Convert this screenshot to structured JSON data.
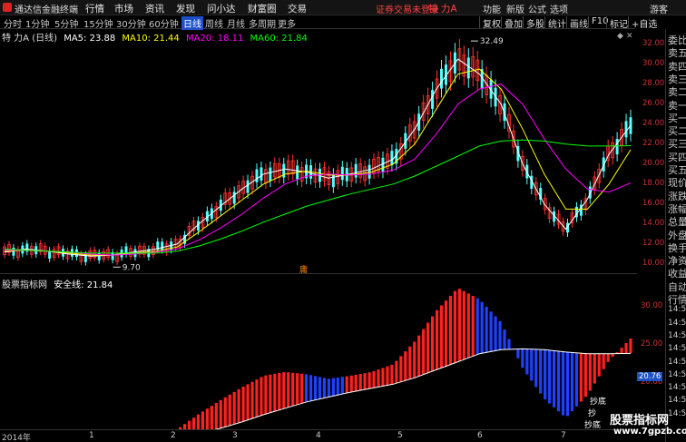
{
  "app": {
    "title": "通达信金融终端",
    "menu": [
      "行情",
      "市场",
      "资讯",
      "发现",
      "问小达",
      "财富圈",
      "交易"
    ],
    "notice": "证券交易未登录",
    "security": "特 力A",
    "menu_right": [
      "功能",
      "新版",
      "公式",
      "选项",
      "游客"
    ]
  },
  "toolbar": {
    "periods": [
      "分时",
      "1分钟",
      "5分钟",
      "15分钟",
      "30分钟",
      "60分钟",
      "日线",
      "周线",
      "月线",
      "多周期",
      "更多"
    ],
    "active_period": "日线",
    "functions": [
      "复权",
      "叠加",
      "多股",
      "统计",
      "画线",
      "F10",
      "标记",
      "+自选"
    ]
  },
  "main_legend": {
    "name": "特 力A (日线)",
    "ma5": "MA5: 23.88",
    "ma10": "MA10: 21.44",
    "ma20": "MA20: 18.11",
    "ma60": "MA60: 21.84"
  },
  "indicator_legend": {
    "name": "股票指标网",
    "label": "安全线: 21.84"
  },
  "price_axis": [
    "32.00",
    "30.00",
    "28.00",
    "26.00",
    "24.00",
    "22.00",
    "20.00",
    "18.00",
    "16.00",
    "14.00",
    "12.00",
    "10.00"
  ],
  "indicator_axis": [
    "30.00",
    "25.00",
    "20.00"
  ],
  "indicator_value": "20.76",
  "date_axis": [
    "2014年",
    "1",
    "2",
    "3",
    "4",
    "5",
    "6",
    "7"
  ],
  "annotations": {
    "high": "32.49",
    "low": "9.70",
    "marker": "庸",
    "buy_labels": [
      "抄底",
      "抄",
      "抄底"
    ]
  },
  "quote_panel": [
    "委比",
    "卖五",
    "卖四",
    "卖三",
    "卖二",
    "卖一",
    "买一",
    "买二",
    "买三",
    "买四",
    "买五",
    "现价",
    "涨跌",
    "涨幅",
    "总量",
    "外盘",
    "换手",
    "净资",
    "收益",
    "自动",
    "行情",
    "14:55",
    "14:56",
    "14:56",
    "14:56",
    "14:56",
    "14:56",
    "14:56",
    "14:56",
    "14:56"
  ],
  "watermark": {
    "name": "股票指标网",
    "url": "www.7gpzb.com"
  },
  "colors": {
    "up": "#ff3232",
    "down": "#54ffff",
    "ma5": "#ffffff",
    "ma10": "#ffff00",
    "ma20": "#ff00ff",
    "ma60": "#00ff00",
    "red_bar": "#ff2020",
    "blue_bar": "#2040ff",
    "safe_line": "#ffffff"
  },
  "chart_data": {
    "type": "line",
    "series": [
      {
        "name": "MA5",
        "values": [
          11.2,
          11.5,
          11.3,
          11.0,
          10.8,
          10.9,
          11.2,
          11.5,
          12.0,
          14.0,
          15.8,
          17.5,
          19.0,
          19.5,
          19.2,
          18.6,
          19.0,
          19.5,
          20.5,
          23.5,
          27.5,
          30.5,
          29.0,
          26.0,
          20.0,
          16.0,
          13.5,
          16.5,
          21.0,
          23.88
        ]
      },
      {
        "name": "MA10",
        "values": [
          11.3,
          11.4,
          11.3,
          11.1,
          10.9,
          10.9,
          11.1,
          11.3,
          11.7,
          13.2,
          14.8,
          16.4,
          18.0,
          19.0,
          19.3,
          18.9,
          18.9,
          19.2,
          20.0,
          22.0,
          25.5,
          29.0,
          29.5,
          27.5,
          23.5,
          19.0,
          15.5,
          15.5,
          18.0,
          21.44
        ]
      },
      {
        "name": "MA20",
        "values": [
          11.4,
          11.4,
          11.3,
          11.2,
          11.0,
          10.9,
          11.0,
          11.2,
          11.5,
          12.4,
          13.6,
          15.0,
          16.6,
          18.0,
          18.8,
          19.0,
          18.9,
          19.0,
          19.4,
          20.5,
          23.0,
          26.0,
          27.5,
          28.0,
          26.0,
          22.5,
          19.5,
          17.5,
          17.2,
          18.11
        ]
      },
      {
        "name": "MA60",
        "values": [
          11.5,
          11.4,
          11.3,
          11.2,
          11.1,
          11.1,
          11.1,
          11.1,
          11.3,
          11.8,
          12.5,
          13.3,
          14.2,
          15.0,
          15.8,
          16.4,
          17.0,
          17.5,
          18.0,
          18.8,
          19.8,
          20.8,
          21.8,
          22.3,
          22.4,
          22.3,
          22.0,
          21.8,
          21.8,
          21.84
        ]
      }
    ],
    "ylim": [
      9.0,
      33.5
    ],
    "annotations": {
      "high": 32.49,
      "low": 9.7
    }
  }
}
